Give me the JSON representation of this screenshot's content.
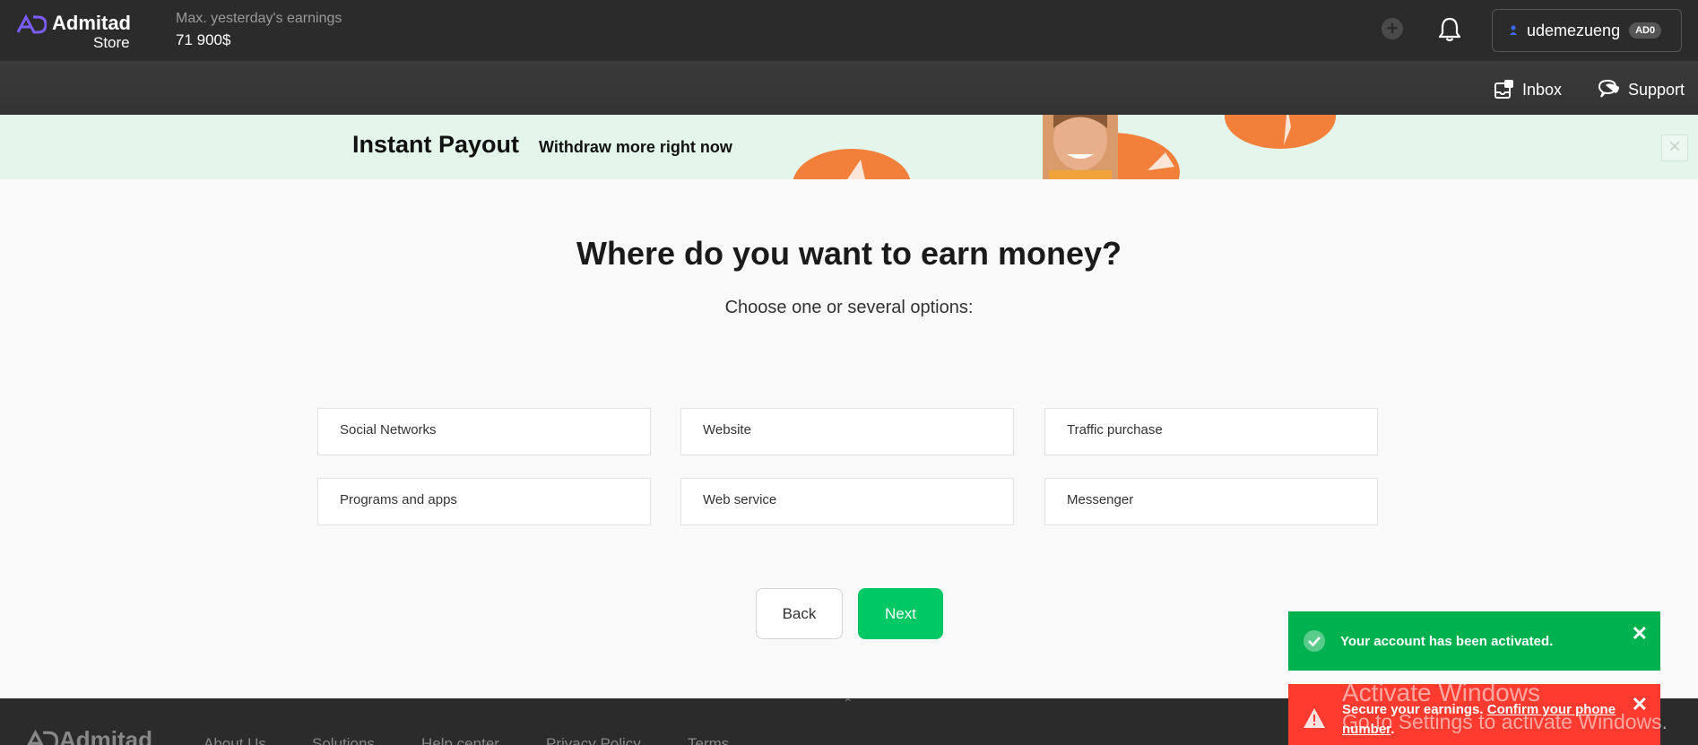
{
  "header": {
    "brand": "Admitad",
    "brand_sub": "Store",
    "earnings_label": "Max. yesterday's earnings",
    "earnings_value": "71 900$",
    "username": "udemezueng",
    "user_badge": "AD0",
    "inbox_label": "Inbox",
    "support_label": "Support",
    "accent_color": "#7b5cff"
  },
  "banner": {
    "title": "Instant Payout",
    "subtitle": "Withdraw more right now",
    "close_glyph": "×"
  },
  "main": {
    "title": "Where do you want to earn money?",
    "subtitle": "Choose one or several options:",
    "options": [
      "Social Networks",
      "Website",
      "Traffic purchase",
      "Programs and apps",
      "Web service",
      "Messenger"
    ],
    "back_label": "Back",
    "next_label": "Next",
    "next_color": "#00c865"
  },
  "footer": {
    "brand": "Admitad",
    "links": [
      "About Us",
      "Solutions",
      "Help center",
      "Privacy Policy",
      "Terms"
    ]
  },
  "toasts": {
    "success_text": "Your account has been activated.",
    "error_prefix": "Secure your earnings.",
    "error_link_line1": "Confirm your phone",
    "error_link_line2": "number",
    "error_suffix": ".",
    "close_glyph": "✕"
  },
  "watermark": {
    "line1": "Activate Windows",
    "line2": "Go to Settings to activate Windows."
  }
}
